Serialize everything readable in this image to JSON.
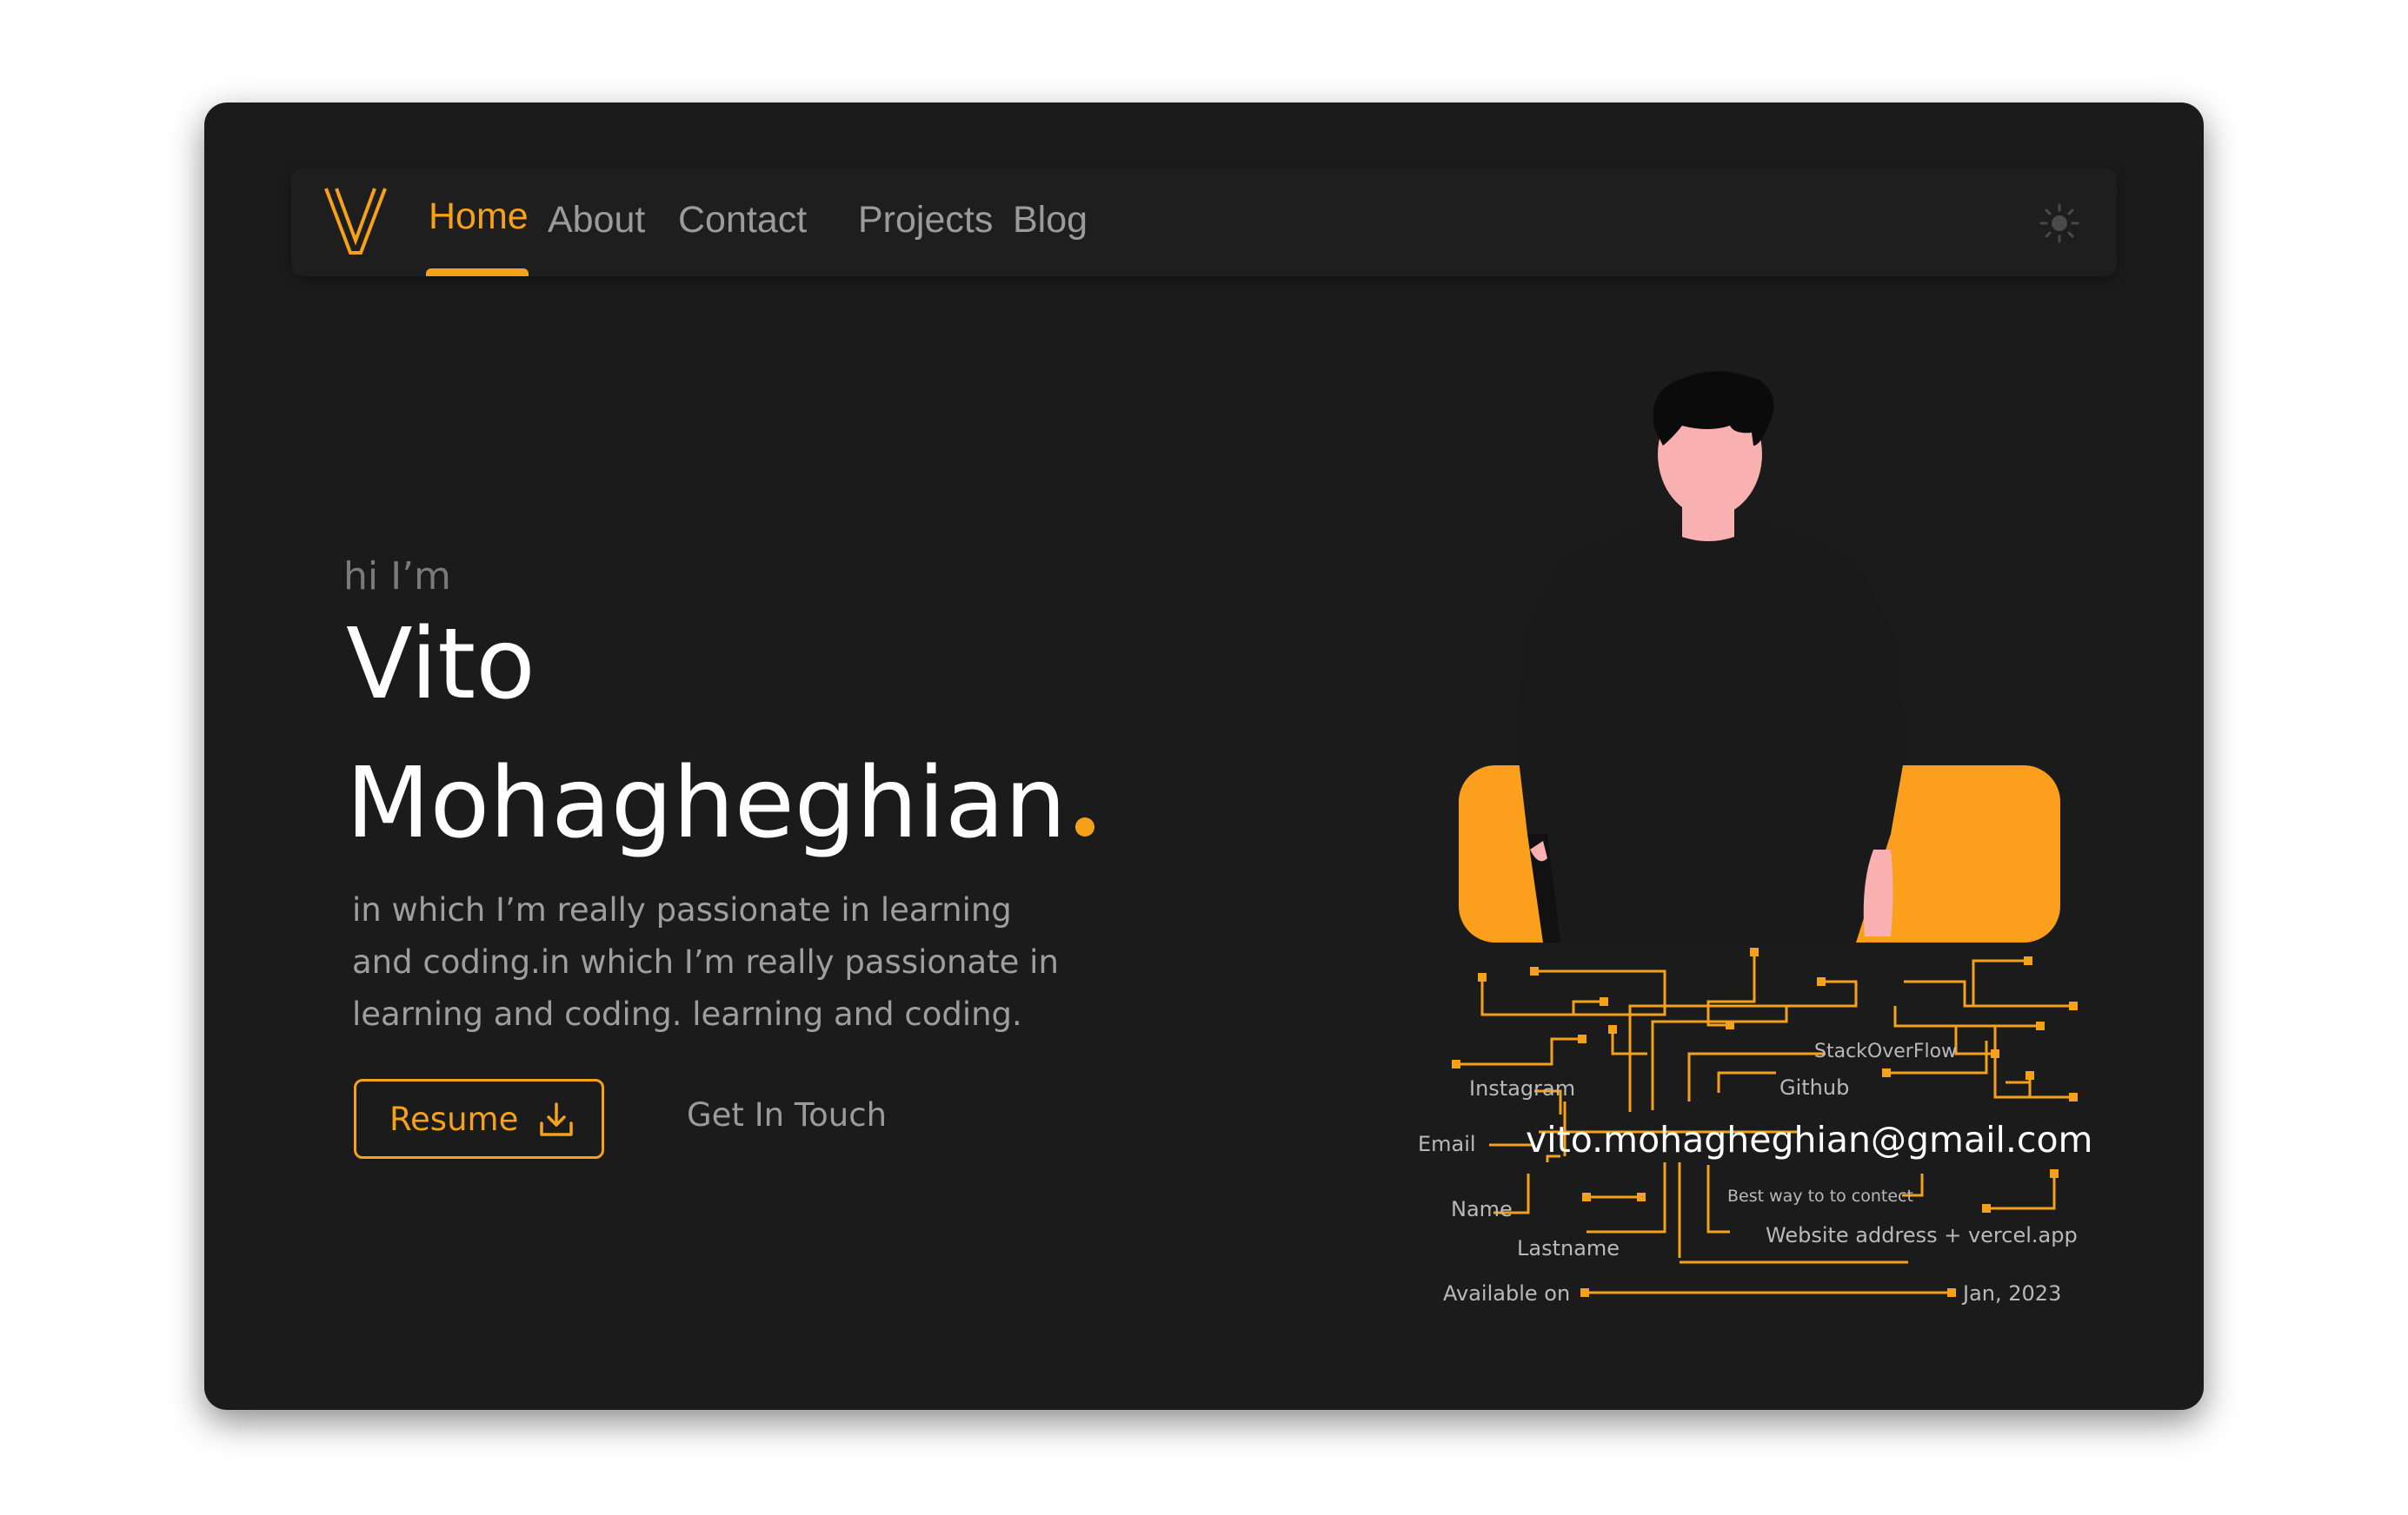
{
  "nav": {
    "logo_letter": "V",
    "items": [
      {
        "label": "Home",
        "active": true
      },
      {
        "label": "About",
        "active": false
      },
      {
        "label": "Contact",
        "active": false
      },
      {
        "label": "Projects",
        "active": false
      },
      {
        "label": "Blog",
        "active": false
      }
    ]
  },
  "hero": {
    "greeting": "hi I’m",
    "first_name": "Vito",
    "last_name": "Mohagheghian",
    "description": "in which I’m really passionate in learning and coding.in which I’m really passionate in learning and coding. learning and coding.",
    "resume_label": "Resume",
    "get_in_touch_label": "Get In Touch"
  },
  "circuit": {
    "stackoverflow": "StackOverFlow",
    "instagram": "Instagram",
    "github": "Github",
    "email_label": "Email",
    "email_value": "vito.mohagheghian@gmail.com",
    "best_way": "Best way to to contect",
    "name_label": "Name",
    "lastname_label": "Lastname",
    "website": "Website address + vercel.app",
    "available_label": "Available on",
    "available_date": "Jan, 2023"
  },
  "colors": {
    "accent": "#f5a11a",
    "background": "#1b1b1c",
    "text_muted": "#9b9b9b"
  },
  "icons": [
    "logo-icon",
    "sun-icon",
    "download-icon"
  ]
}
